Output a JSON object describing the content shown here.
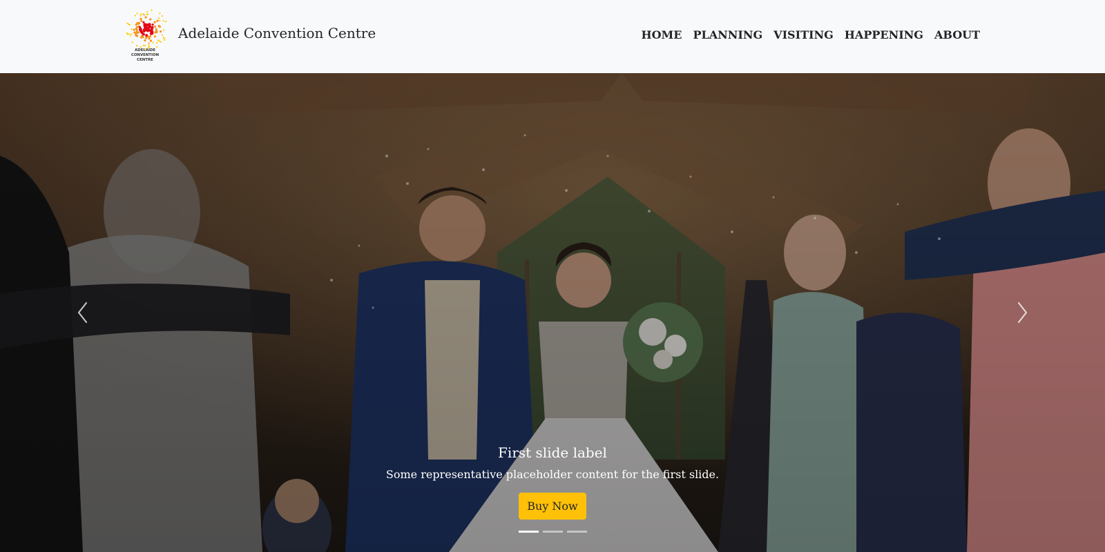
{
  "brand": {
    "name": "Adelaide Convention Centre",
    "logo_text_lines": [
      "ADELAIDE",
      "CONVENTION",
      "CENTRE"
    ],
    "logo_colors": [
      "#e30613",
      "#f7931e",
      "#ffcc00"
    ]
  },
  "nav": {
    "items": [
      {
        "label": "HOME"
      },
      {
        "label": "PLANNING"
      },
      {
        "label": "VISITING"
      },
      {
        "label": "HAPPENING"
      },
      {
        "label": "ABOUT"
      }
    ]
  },
  "carousel": {
    "image_alt": "",
    "slide": {
      "title": "First slide label",
      "text": "Some representative placeholder content for the first slide.",
      "button": "Buy Now"
    },
    "slide_count": 3,
    "active_index": 0,
    "prev_icon": "chevron-left-icon",
    "next_icon": "chevron-right-icon"
  },
  "colors": {
    "button_bg": "#ffc107",
    "navbar_bg": "#f8f9fa",
    "text": "#212529"
  }
}
